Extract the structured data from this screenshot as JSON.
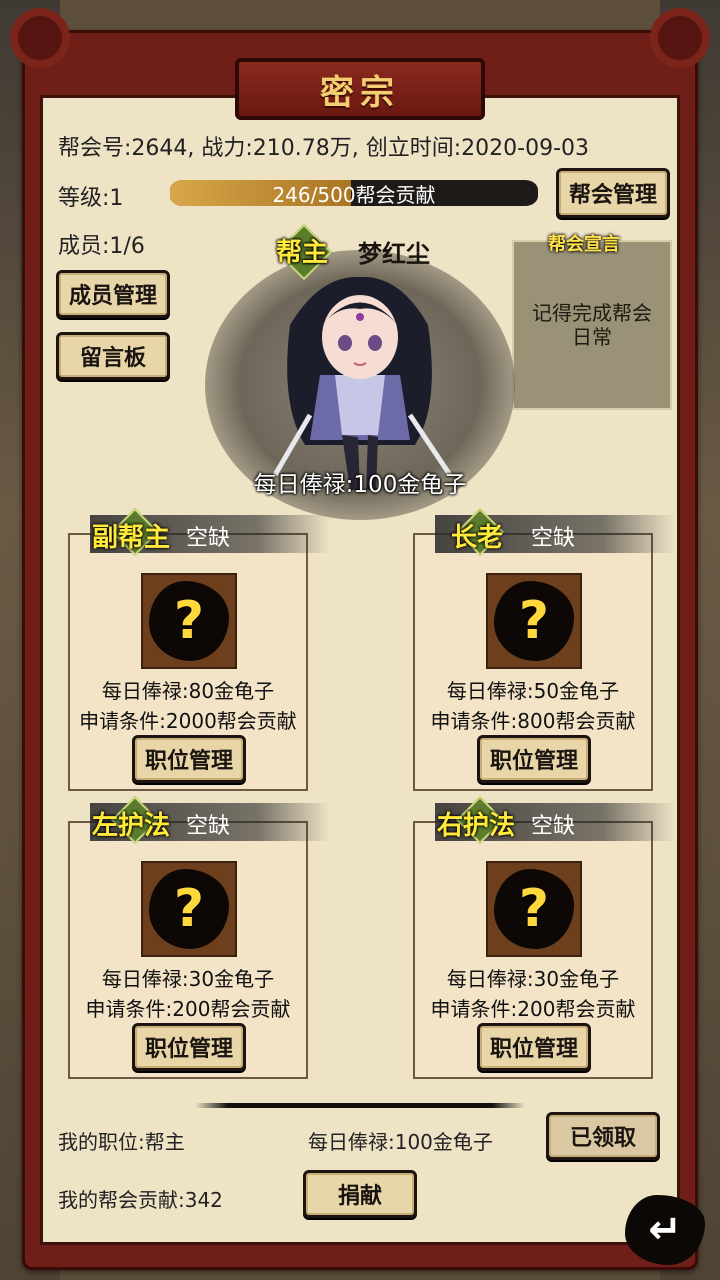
{
  "title": "密宗",
  "info_line": "帮会号:2644, 战力:210.78万, 创立时间:2020-09-03",
  "level_label": "等级:1",
  "contribution_progress": {
    "text": "246/500帮会贡献",
    "fraction": 0.492
  },
  "manage_guild_button": "帮会管理",
  "members_label": "成员:1/6",
  "member_manage_button": "成员管理",
  "message_board_button": "留言板",
  "announcement": {
    "title": "帮会宣言",
    "text": "记得完成帮会日常"
  },
  "leader": {
    "rank": "帮主",
    "name": "梦红尘",
    "salary": "每日俸禄:100金龟子"
  },
  "slots": [
    {
      "rank": "副帮主",
      "status": "空缺",
      "salary": "每日俸禄:80金龟子",
      "requirement": "申请条件:2000帮会贡献",
      "button": "职位管理"
    },
    {
      "rank": "长老",
      "status": "空缺",
      "salary": "每日俸禄:50金龟子",
      "requirement": "申请条件:800帮会贡献",
      "button": "职位管理"
    },
    {
      "rank": "左护法",
      "status": "空缺",
      "salary": "每日俸禄:30金龟子",
      "requirement": "申请条件:200帮会贡献",
      "button": "职位管理"
    },
    {
      "rank": "右护法",
      "status": "空缺",
      "salary": "每日俸禄:30金龟子",
      "requirement": "申请条件:200帮会贡献",
      "button": "职位管理"
    }
  ],
  "footer": {
    "my_position": "我的职位:帮主",
    "my_salary": "每日俸禄:100金龟子",
    "claimed_button": "已领取",
    "my_contribution": "我的帮会贡献:342",
    "donate_button": "捐献"
  },
  "icons": {
    "vacant": "question-mark-icon",
    "back": "back-arrow-icon"
  },
  "colors": {
    "frame": "#6f1f17",
    "panel": "#efe3c6",
    "rank_text": "#ffe93a",
    "title_text": "#f4cf72"
  }
}
